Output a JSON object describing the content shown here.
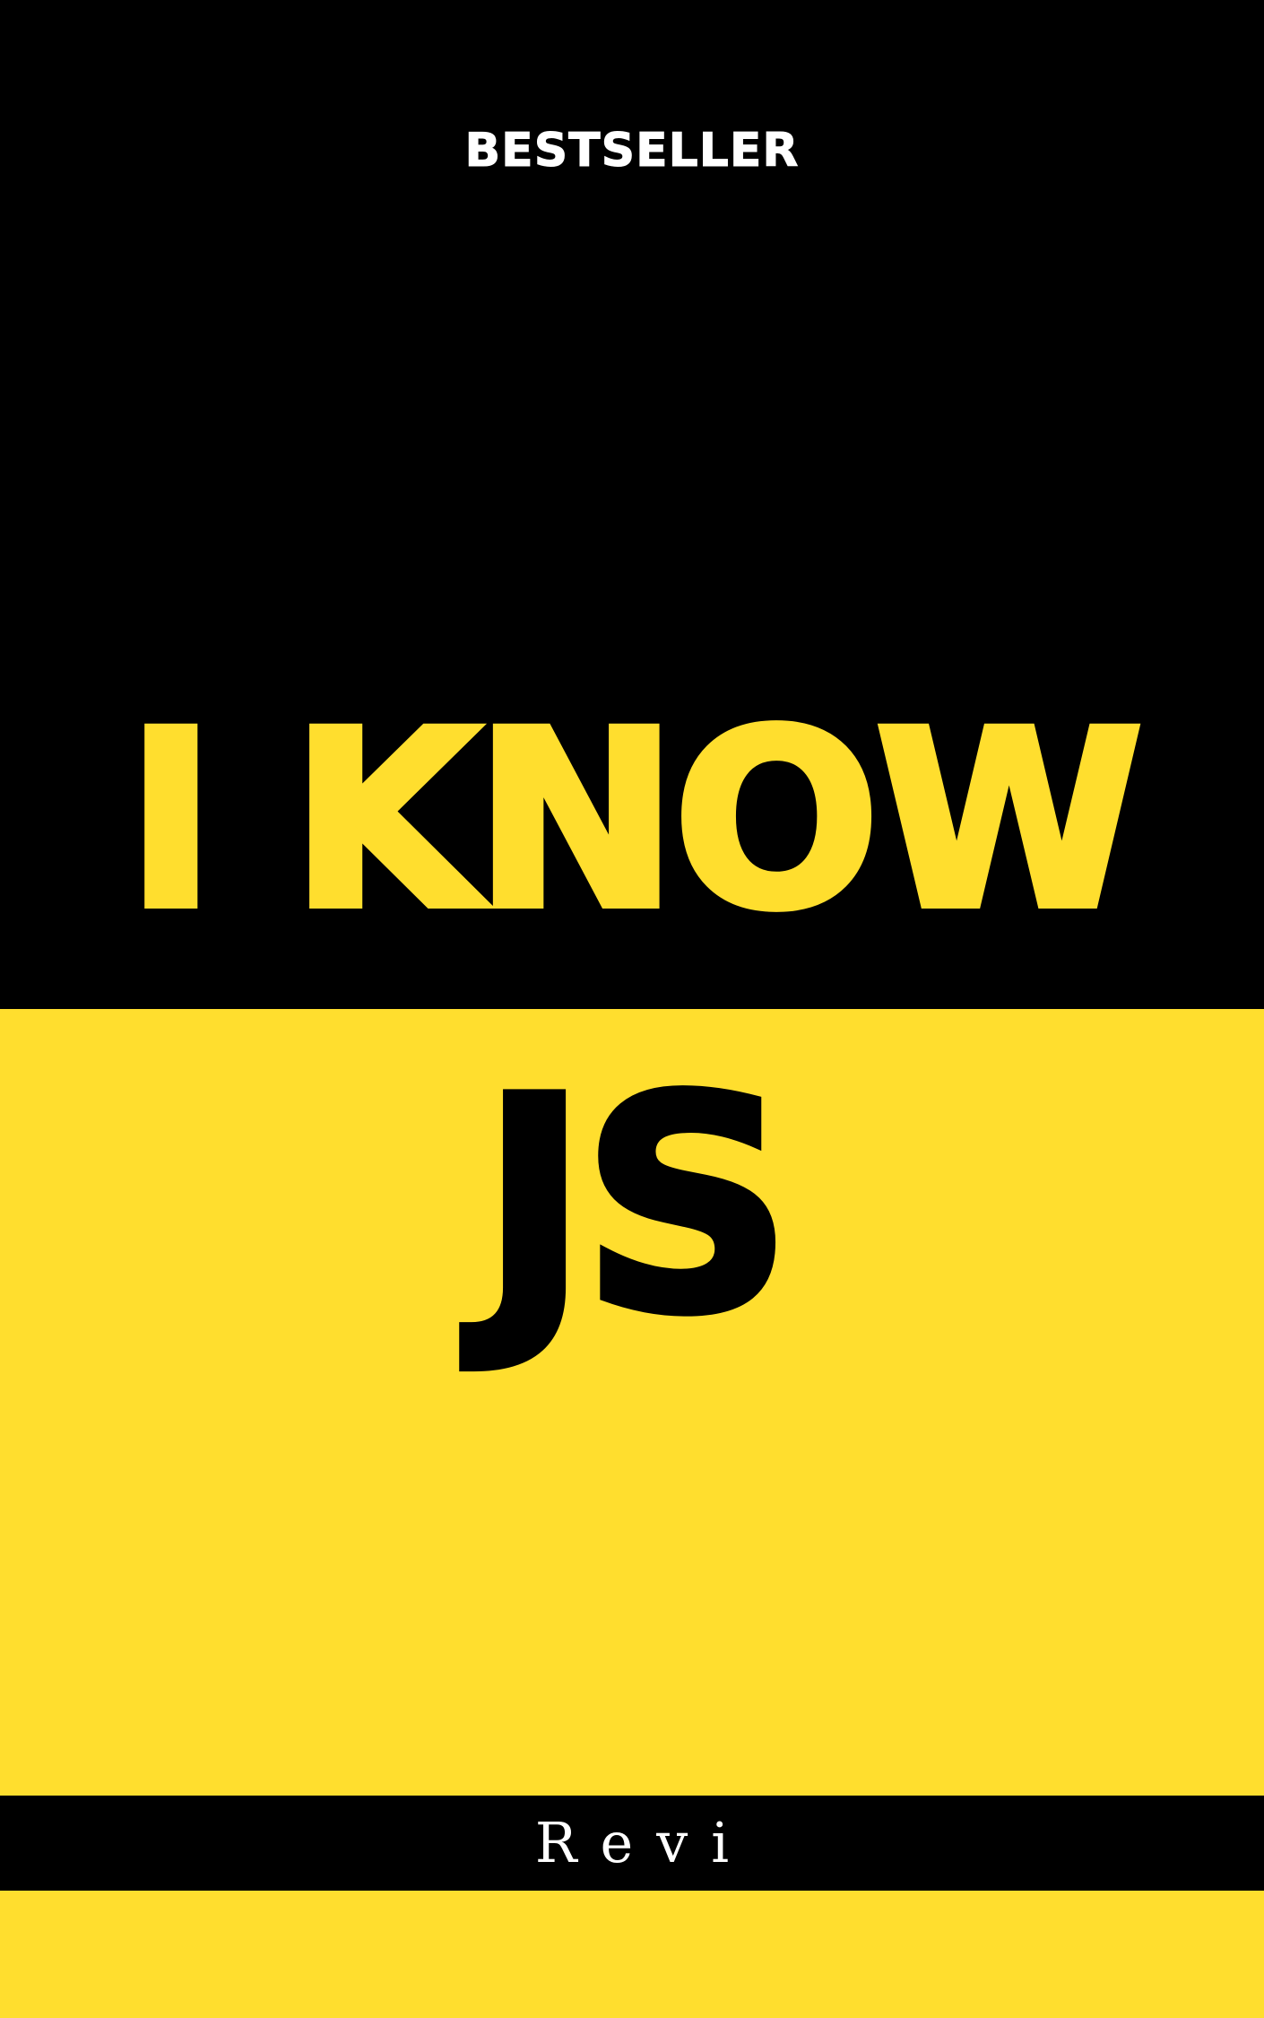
{
  "cover": {
    "badge": "BESTSELLER",
    "title_line_1": "I KNOW",
    "title_line_2": "JS",
    "author": "Revi"
  },
  "colors": {
    "black": "#000000",
    "yellow": "#FFDE2E",
    "white": "#FFFFFF"
  }
}
